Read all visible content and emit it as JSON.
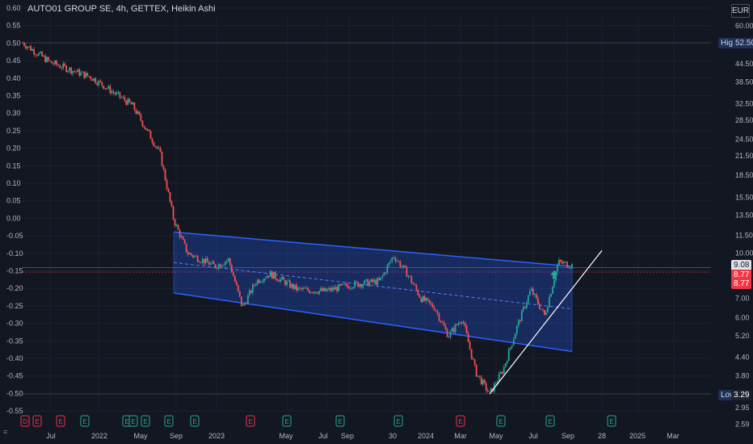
{
  "header": {
    "title": "AUTO01 GROUP SE, 4h, GETTEX, Heikin Ashi",
    "currency": "EUR"
  },
  "left_axis": [
    "0.60",
    "0.55",
    "0.50",
    "0.45",
    "0.40",
    "0.35",
    "0.30",
    "0.25",
    "0.20",
    "0.15",
    "0.10",
    "0.05",
    "0.00",
    "-0.05",
    "-0.10",
    "-0.15",
    "-0.20",
    "-0.25",
    "-0.30",
    "-0.35",
    "-0.40",
    "-0.45",
    "-0.50",
    "-0.55"
  ],
  "right_axis": [
    "60.00",
    "52.50",
    "44.50",
    "38.50",
    "32.50",
    "28.50",
    "24.50",
    "21.50",
    "18.50",
    "15.50",
    "13.50",
    "11.50",
    "10.00",
    "9.08",
    "8.77",
    "7.00",
    "6.00",
    "5.20",
    "4.40",
    "3.80",
    "3.29",
    "2.95",
    "2.59"
  ],
  "x_axis": [
    "Jul",
    "2022",
    "May",
    "Sep",
    "2023",
    "May",
    "Jul",
    "Sep",
    "30",
    "2024",
    "Mar",
    "May",
    "Jul",
    "Sep",
    "28",
    "2025",
    "Mar"
  ],
  "markers": {
    "high": {
      "label": "High",
      "value": "52.50"
    },
    "low": {
      "label": "Low",
      "value": "3.29"
    },
    "last": "9.08",
    "price_a": "8.77",
    "price_b": "8.77"
  },
  "events": [
    {
      "letter": "D",
      "color": "#f23645"
    },
    {
      "letter": "E",
      "color": "#f23645"
    },
    {
      "letter": "E",
      "color": "#f23645"
    },
    {
      "letter": "E",
      "color": "#22ab94"
    },
    {
      "letter": "E",
      "color": "#22ab94"
    },
    {
      "letter": "E",
      "color": "#22ab94"
    },
    {
      "letter": "E",
      "color": "#22ab94"
    },
    {
      "letter": "E",
      "color": "#22ab94"
    },
    {
      "letter": "E",
      "color": "#22ab94"
    },
    {
      "letter": "E",
      "color": "#f23645"
    },
    {
      "letter": "E",
      "color": "#22ab94"
    },
    {
      "letter": "E",
      "color": "#22ab94"
    },
    {
      "letter": "E",
      "color": "#22ab94"
    },
    {
      "letter": "E",
      "color": "#f23645"
    },
    {
      "letter": "E",
      "color": "#22ab94"
    },
    {
      "letter": "E",
      "color": "#22ab94"
    },
    {
      "letter": "E",
      "color": "#22ab94"
    },
    {
      "letter": "E",
      "color": "#d500f9"
    }
  ],
  "chart_data": {
    "type": "line",
    "style": "heikin-ashi candles",
    "title": "AUTO01 GROUP SE, 4h, GETTEX, Heikin Ashi",
    "scale": "log",
    "x": [
      "2021-05",
      "2021-07",
      "2021-10",
      "2022-01",
      "2022-03",
      "2022-04",
      "2022-05",
      "2022-06",
      "2022-07",
      "2022-08",
      "2022-09",
      "2022-10",
      "2022-11",
      "2022-12",
      "2023-01",
      "2023-03",
      "2023-05",
      "2023-07",
      "2023-08",
      "2023-09",
      "2023-10",
      "2023-11",
      "2023-12",
      "2024-01",
      "2024-02",
      "2024-03",
      "2024-04",
      "2024-05",
      "2024-06",
      "2024-07",
      "2024-08",
      "2024-09"
    ],
    "series": [
      {
        "values": [
          52.5,
          45,
          40,
          32,
          22,
          13,
          10,
          9.5,
          9,
          9.5,
          6.5,
          8,
          8.5,
          8,
          7.5,
          7.4,
          7.8,
          8,
          9.8,
          8.5,
          7,
          6.5,
          5.2,
          6,
          3.9,
          3.29,
          4,
          5.6,
          7.5,
          6.1,
          9.3,
          9.08
        ]
      }
    ],
    "channel": {
      "upper": [
        11.8,
        9.0
      ],
      "lower": [
        7.3,
        4.6
      ],
      "from": "2022-04",
      "to": "2024-09"
    },
    "trendline": {
      "from": [
        "2024-03",
        3.29
      ],
      "to": [
        "2024-10",
        10.2
      ]
    },
    "ylim": [
      2.59,
      60.0
    ],
    "grid": true
  }
}
